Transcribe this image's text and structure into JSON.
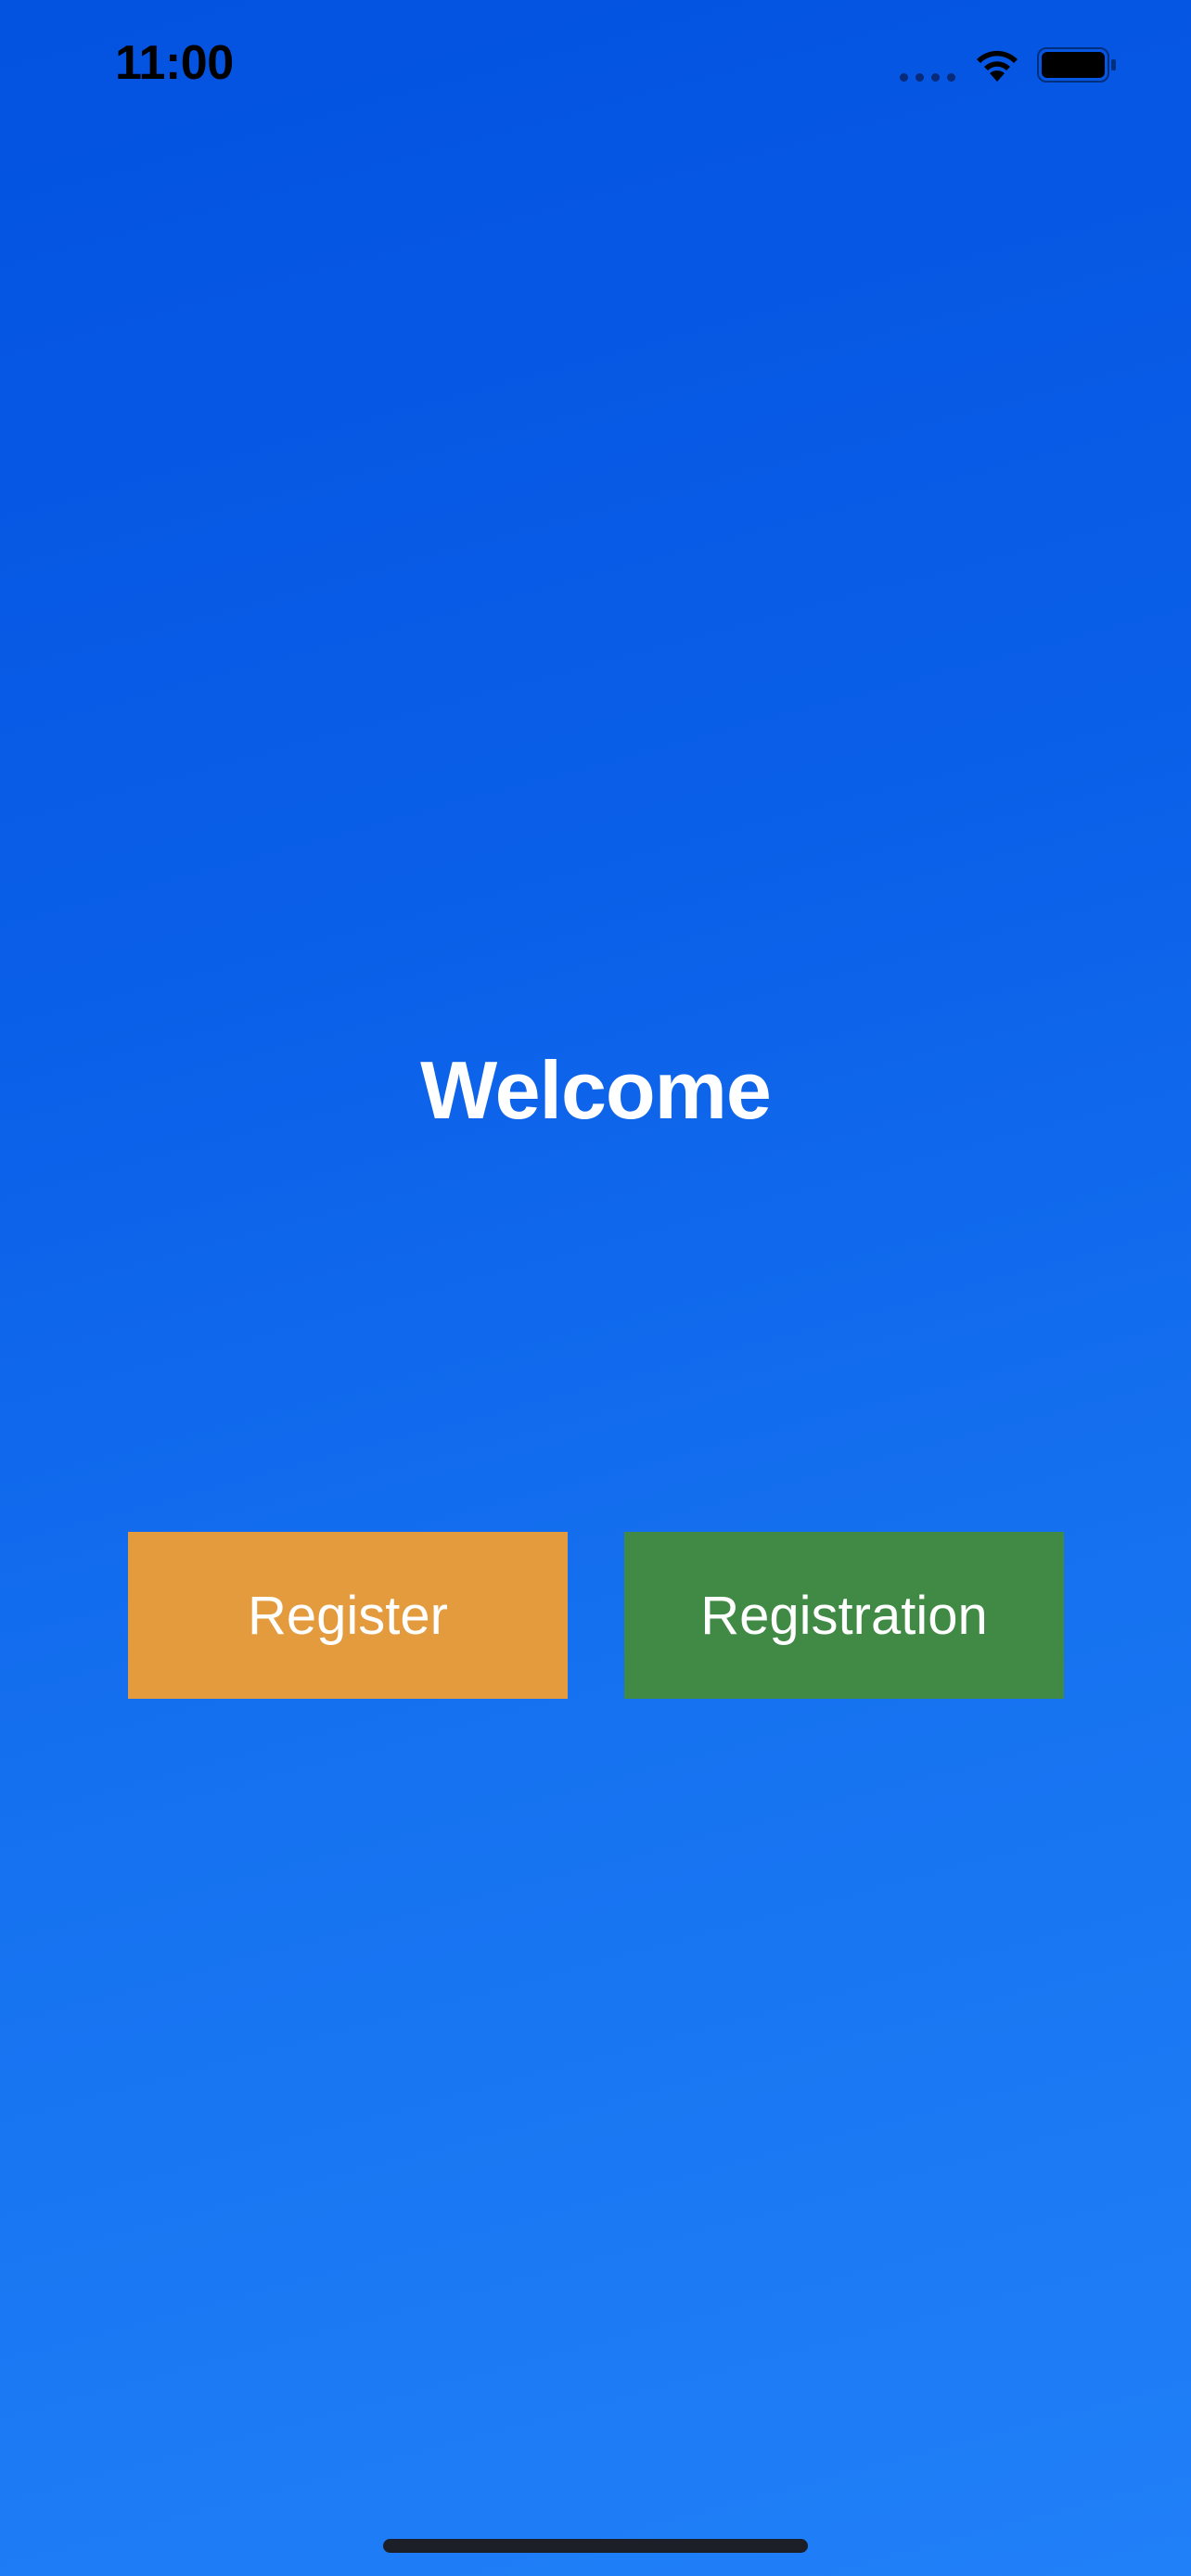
{
  "status_bar": {
    "time": "11:00",
    "icons": [
      "signal-dots-icon",
      "wifi-icon",
      "battery-icon"
    ]
  },
  "main": {
    "title": "Welcome"
  },
  "buttons": {
    "register_label": "Register",
    "registration_label": "Registration"
  },
  "colors": {
    "background_top": "#0352e0",
    "background_bottom": "#2080f8",
    "register_button": "#e39b3d",
    "registration_button": "#408a45",
    "text": "#ffffff"
  }
}
